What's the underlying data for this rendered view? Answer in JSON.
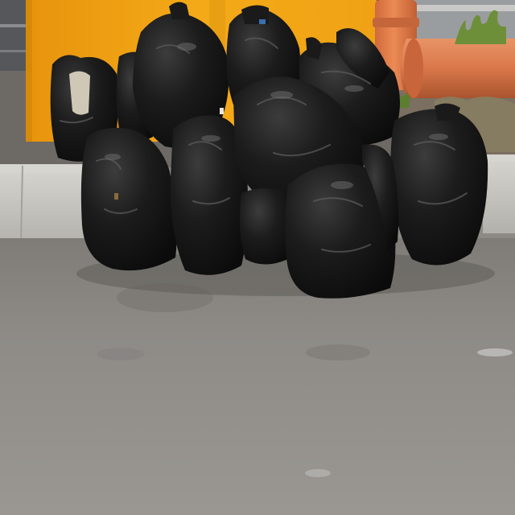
{
  "scene": {
    "kind": "photo",
    "subject": "pile-of-black-garbage-bags",
    "colors": {
      "pavement": "#8e8b87",
      "pavement_dark": "#6f6c68",
      "wall": "#f2a413",
      "wall_shadow": "#c97f0b",
      "curb": "#c9c7c2",
      "curb_shadow": "#9d9b96",
      "pipe": "#d9774a",
      "pipe_dark": "#b55a33",
      "bag": "#161616",
      "bag_highlight": "#4a4a4a",
      "grass": "#6e8f3a"
    }
  }
}
